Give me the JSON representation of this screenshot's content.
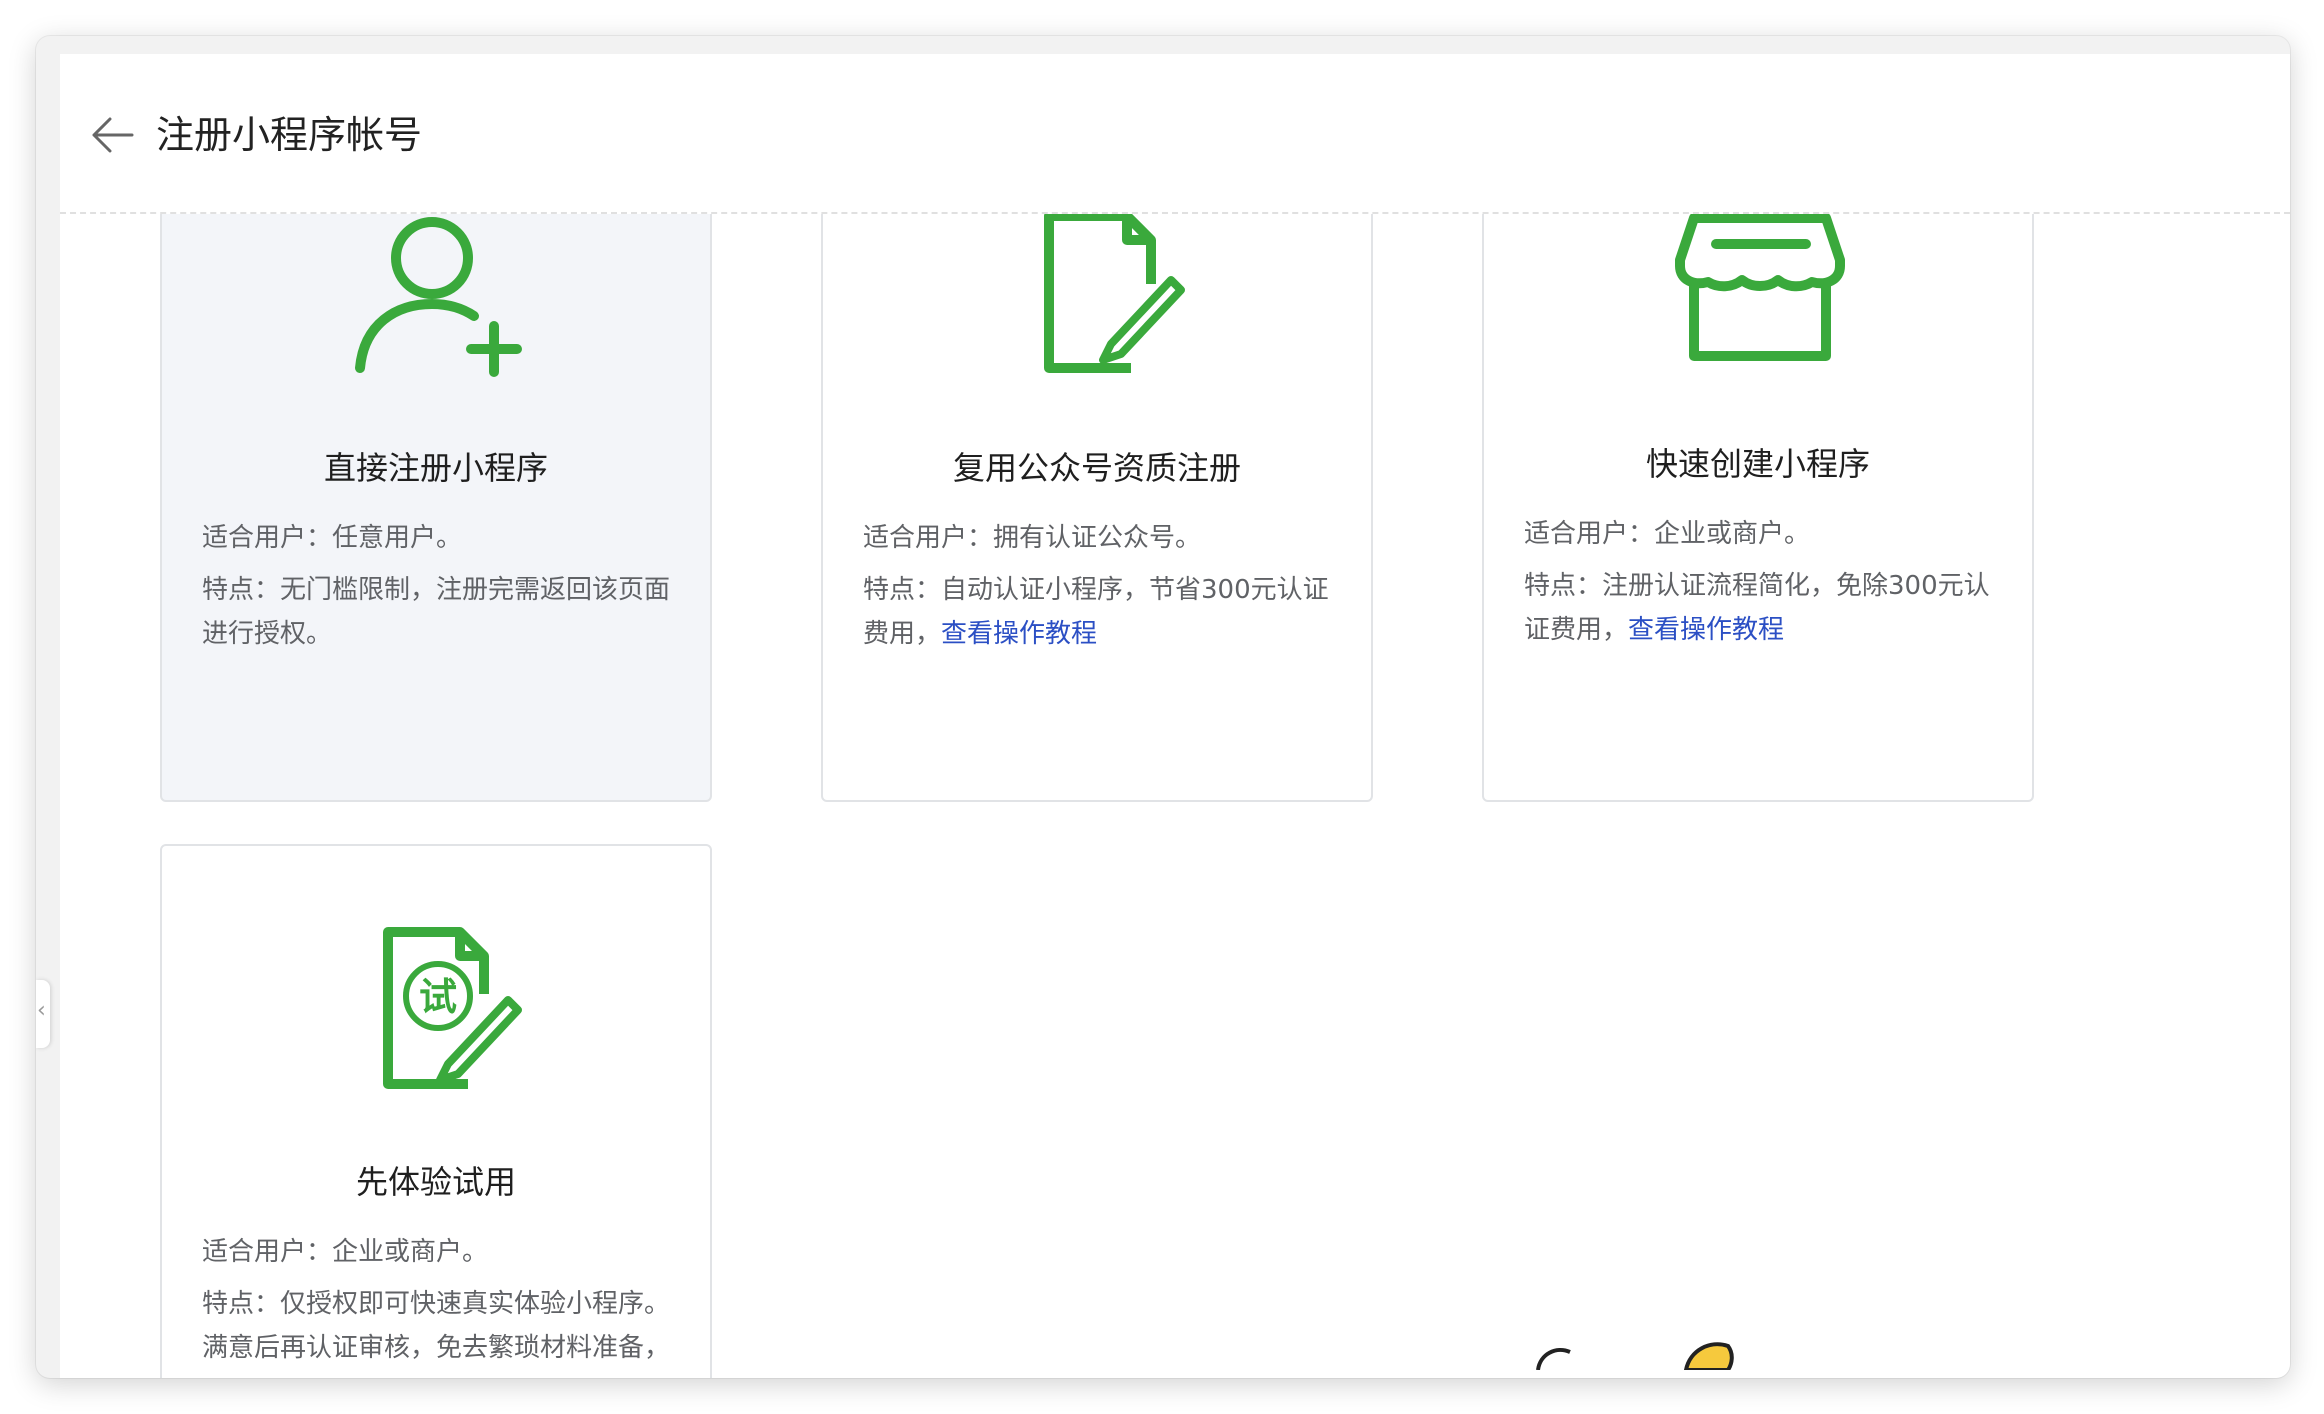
{
  "header": {
    "title": "注册小程序帐号"
  },
  "cards": [
    {
      "title": "直接注册小程序",
      "users": "适合用户：任意用户。",
      "feature": "特点：无门槛限制，注册完需返回该页面进行授权。",
      "link": ""
    },
    {
      "title": "复用公众号资质注册",
      "users": "适合用户：拥有认证公众号。",
      "feature": "特点：自动认证小程序，节省300元认证费用，",
      "link": "查看操作教程"
    },
    {
      "title": "快速创建小程序",
      "users": "适合用户：企业或商户。",
      "feature": "特点：注册认证流程简化，免除300元认证费用，",
      "link": "查看操作教程"
    },
    {
      "title": "先体验试用",
      "users": "适合用户：企业或商户。",
      "feature": "特点：仅授权即可快速真实体验小程序。满意后再认证审核，免去繁琐材料准备，",
      "link": ""
    }
  ],
  "icons": {
    "back": "arrow-left-icon",
    "card0": "user-add-icon",
    "card1": "document-edit-icon",
    "card2": "store-icon",
    "card3": "trial-document-icon",
    "trial_glyph": "试"
  },
  "colors": {
    "icon_green": "#3aa93c",
    "link_blue": "#2b4fc4",
    "active_card_bg": "#f3f5f9"
  }
}
